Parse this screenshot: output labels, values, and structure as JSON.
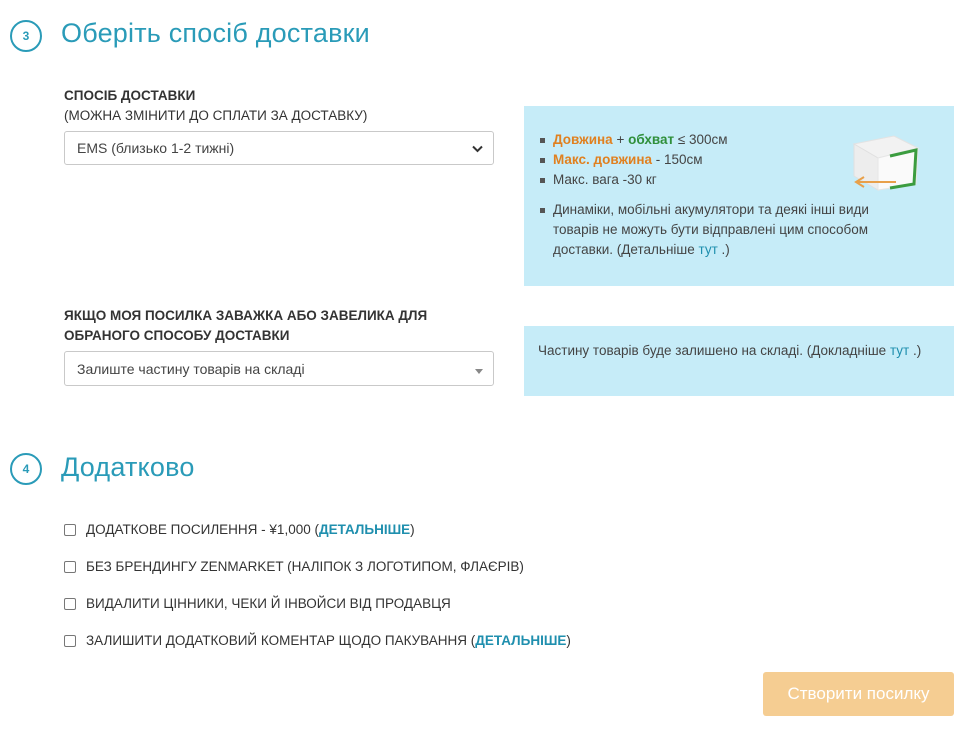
{
  "step3": {
    "number": "3",
    "title": "Оберіть спосіб доставки",
    "method_label": "СПОСІБ ДОСТАВКИ",
    "method_sublabel": "(МОЖНА ЗМІНИТИ ДО СПЛАТИ ЗА ДОСТАВКУ)",
    "method_value": "EMS (близько 1-2 тижні)",
    "info": {
      "dim_label_1": "Довжина",
      "plus": " + ",
      "dim_label_2": "обхват",
      "dim_value": " ≤ 300см",
      "maxlen_label": "Макс. довжина",
      "maxlen_value": " - 150см",
      "maxweight": "Макс. вага -30 кг",
      "note": "Динаміки, мобільні акумулятори та деякі інші види товарів не можуть бути відправлені цим способом доставки. (Детальніше ",
      "note_link": "тут",
      "note_end": " .)"
    },
    "overweight_label": "ЯКЩО МОЯ ПОСИЛКА ЗАВАЖКА АБО ЗАВЕЛИКА ДЛЯ ОБРАНОГО СПОСОБУ ДОСТАВКИ",
    "overweight_value": "Залиште частину товарів на складі",
    "overweight_info": "Частину товарів буде залишено на складі. (Докладніше ",
    "overweight_info_link": "тут",
    "overweight_info_end": " .)"
  },
  "step4": {
    "number": "4",
    "title": "Додатково",
    "options": [
      {
        "label": "ДОДАТКОВЕ ПОСИЛЕННЯ - ¥1,000 (",
        "link": "ДЕТАЛЬНІШЕ",
        "end": ")",
        "checked": false
      },
      {
        "label": "БЕЗ БРЕНДИНГУ ZENMARKET (НАЛІПОК З ЛОГОТИПОМ, ФЛАЄРІВ)",
        "link": "",
        "end": "",
        "checked": false
      },
      {
        "label": "ВИДАЛИТИ ЦІННИКИ, ЧЕКИ Й ІНВОЙСИ ВІД ПРОДАВЦЯ",
        "link": "",
        "end": "",
        "checked": false
      },
      {
        "label": "ЗАЛИШИТИ ДОДАТКОВИЙ КОМЕНТАР ЩОДО ПАКУВАННЯ (",
        "link": "ДЕТАЛЬНІШЕ",
        "end": ")",
        "checked": false
      }
    ]
  },
  "submit_label": "Створити посилку",
  "icons": {
    "method_arrow": "chevron-down-icon",
    "overweight_arrow": "caret-down-icon",
    "box_illustration": "box-icon"
  },
  "colors": {
    "accent": "#2a9bb8",
    "info_bg": "#c6ecf8",
    "orange": "#e0801f",
    "green": "#2f8f3a",
    "submit_bg": "#f5cd92"
  }
}
